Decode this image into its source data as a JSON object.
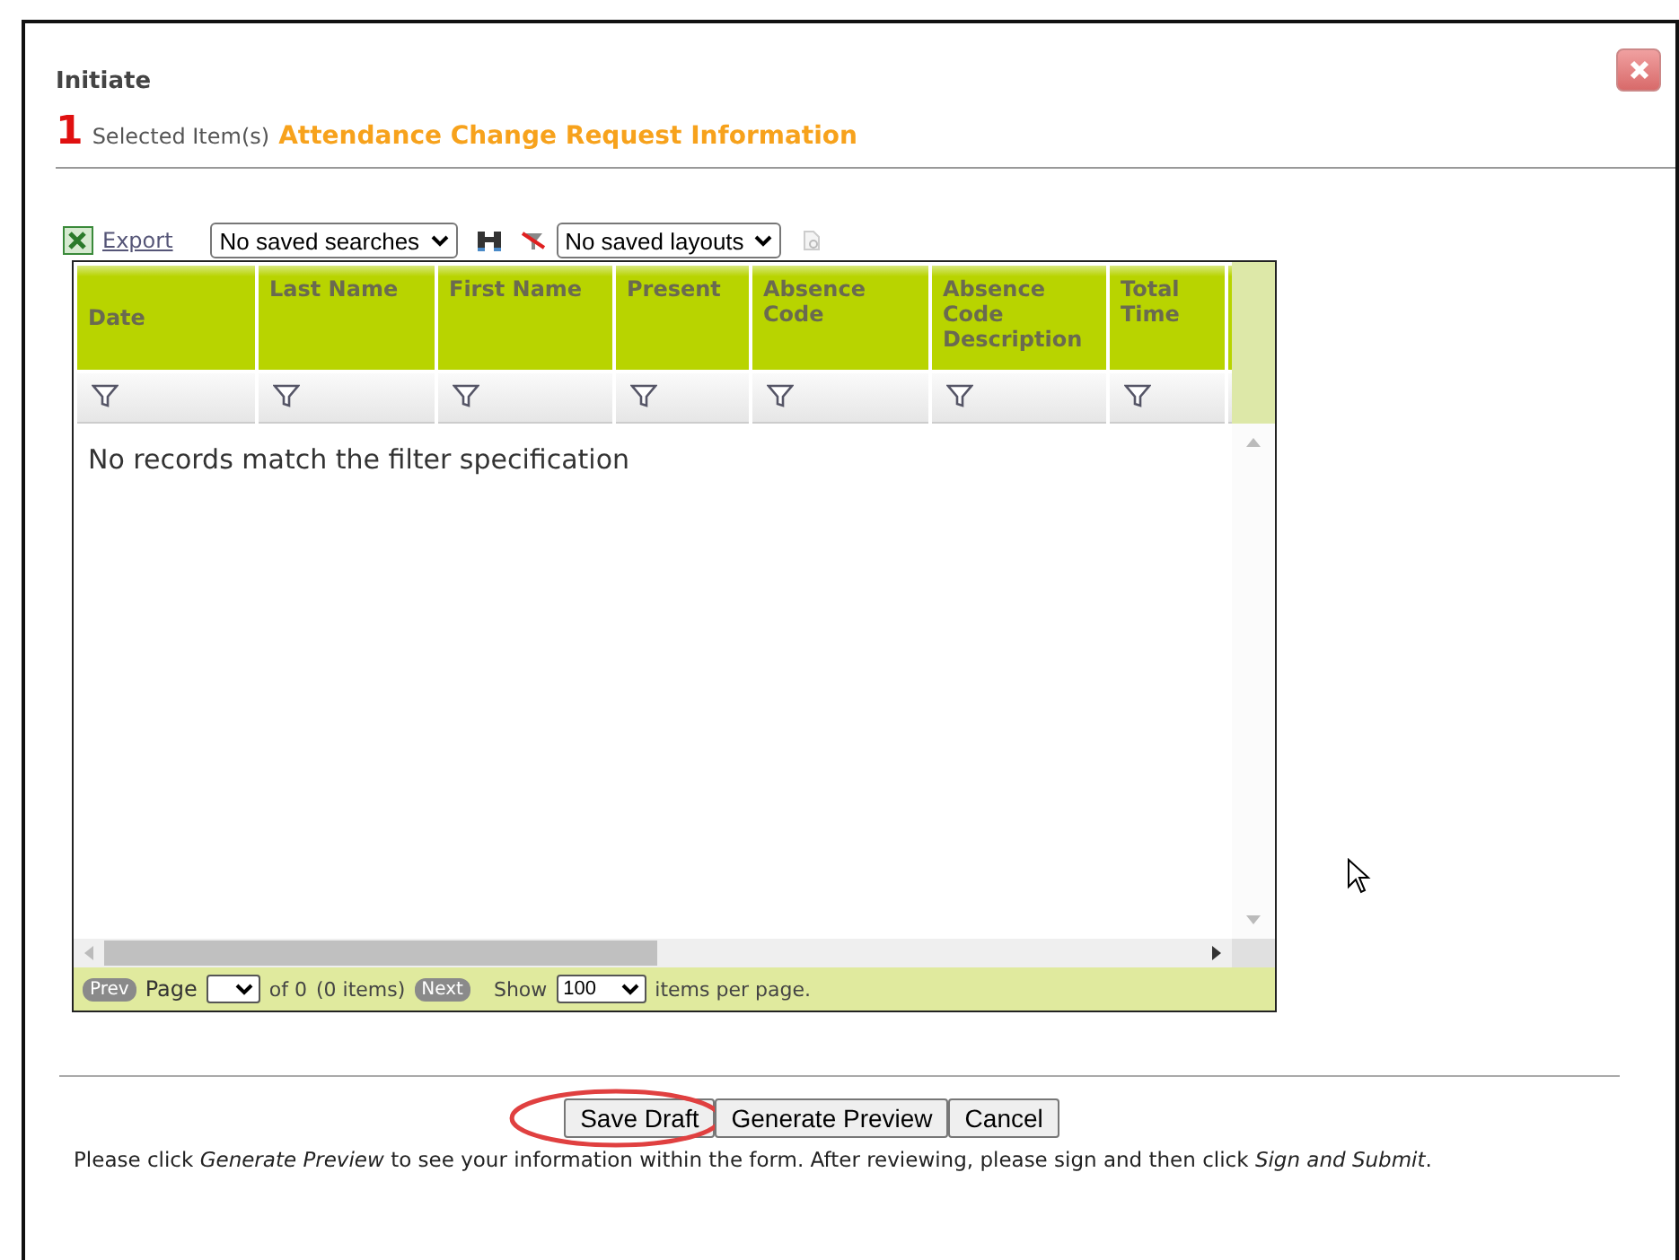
{
  "dialog": {
    "title": "Initiate",
    "selected_count": "1",
    "selected_label": "Selected Item(s)",
    "form_title": "Attendance Change Request Information"
  },
  "toolbar": {
    "export": "Export",
    "saved_searches": "No saved searches",
    "saved_layouts": "No saved layouts"
  },
  "grid": {
    "columns": [
      "Date",
      "Last Name",
      "First Name",
      "Present",
      "Absence Code",
      "Absence Code Description",
      "Total Time"
    ],
    "empty_message": "No records match the filter specification"
  },
  "pager": {
    "prev": {
      "label": "Prev",
      "disabled": true
    },
    "page_label": "Page",
    "of_text": "of 0",
    "items_text": "(0  items)",
    "next": {
      "label": "Next",
      "disabled": true
    },
    "show_label": "Show",
    "page_size": "100",
    "per_page": "items per page."
  },
  "buttons": [
    {
      "label": "Save Draft",
      "highlighted": true
    },
    {
      "label": "Generate Preview",
      "highlighted": false
    },
    {
      "label": "Cancel",
      "highlighted": false
    }
  ],
  "instructions": "Please click *Generate Preview* to see your information within the form. After reviewing, please sign and then click *Sign and Submit*."
}
